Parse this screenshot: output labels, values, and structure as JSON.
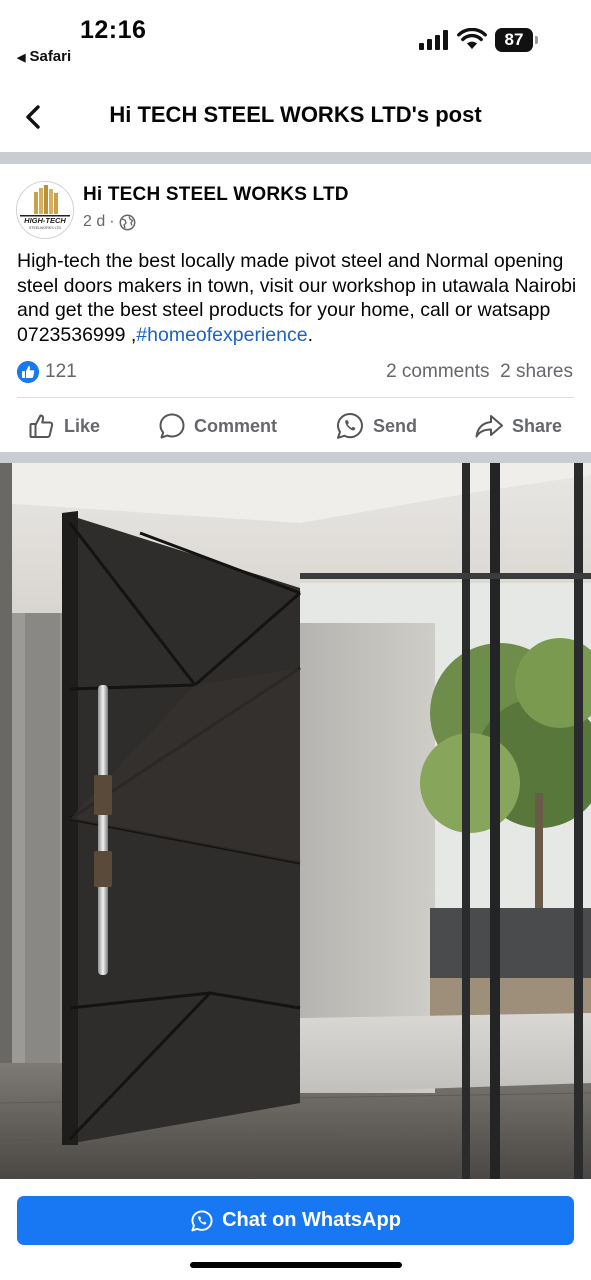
{
  "status_bar": {
    "time": "12:16",
    "back_app": "Safari",
    "battery": "87"
  },
  "header": {
    "title": "Hi TECH STEEL WORKS LTD's post",
    "back_icon": "chevron-left-icon"
  },
  "post": {
    "author": "Hi TECH STEEL WORKS LTD",
    "avatar_text": "HIGH-TECH",
    "avatar_subtext": "STEELWORKS LTD",
    "time": "2 d",
    "separator": "·",
    "privacy_icon": "globe-icon",
    "text": "High-tech the best locally made  pivot steel  and Normal opening steel doors makers in town, visit our workshop in utawala Nairobi and get the best steel products for your home, call or watsapp 0723536999  ,",
    "hashtag": "#homeofexperience",
    "text_end": ".",
    "likes": "121",
    "comments": "2 comments",
    "shares": "2 shares"
  },
  "actions": [
    {
      "label": "Like",
      "icon": "thumbs-up-icon"
    },
    {
      "label": "Comment",
      "icon": "comment-bubble-icon"
    },
    {
      "label": "Send",
      "icon": "whatsapp-icon"
    },
    {
      "label": "Share",
      "icon": "share-arrow-icon"
    }
  ],
  "cta": {
    "label": "Chat on WhatsApp",
    "icon": "whatsapp-icon"
  },
  "colors": {
    "brand_blue": "#1877f2",
    "hashtag_blue": "#1b63c4",
    "secondary_text": "#65676b",
    "divider": "#c9ccd1"
  }
}
